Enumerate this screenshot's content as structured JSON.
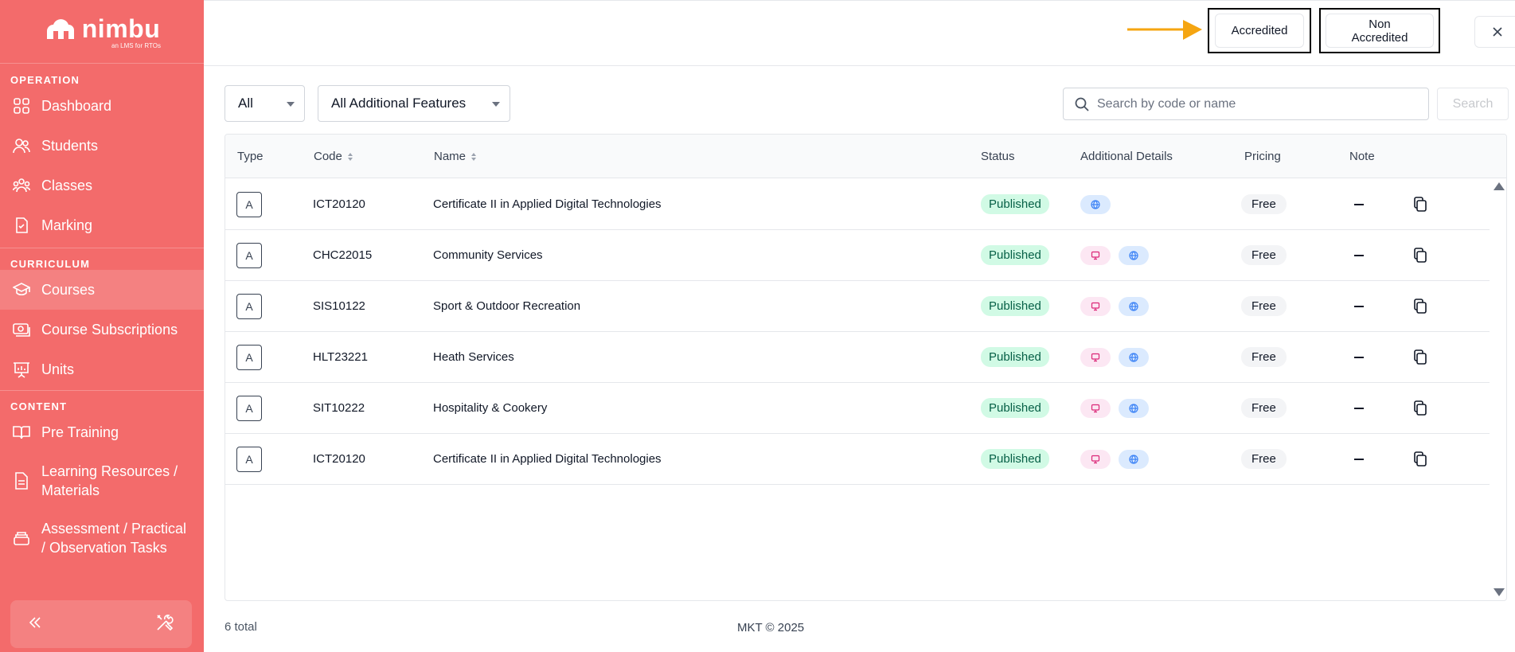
{
  "brand": {
    "name": "nimbu",
    "tagline": "an LMS for RTOs"
  },
  "sidebar": {
    "sections": [
      {
        "label": "OPERATION",
        "items": [
          {
            "label": "Dashboard",
            "icon": "grid-icon"
          },
          {
            "label": "Students",
            "icon": "users-icon"
          },
          {
            "label": "Classes",
            "icon": "group-icon"
          },
          {
            "label": "Marking",
            "icon": "clipboard-check-icon"
          }
        ]
      },
      {
        "label": "CURRICULUM",
        "items": [
          {
            "label": "Courses",
            "icon": "graduation-cap-icon",
            "active": true
          },
          {
            "label": "Course Subscriptions",
            "icon": "money-icon"
          },
          {
            "label": "Units",
            "icon": "presentation-icon"
          }
        ]
      },
      {
        "label": "CONTENT",
        "items": [
          {
            "label": "Pre Training",
            "icon": "book-icon"
          },
          {
            "label": "Learning Resources / Materials",
            "icon": "document-icon"
          },
          {
            "label": "Assessment / Practical / Observation Tasks",
            "icon": "stack-icon"
          }
        ]
      }
    ]
  },
  "topbar": {
    "tabs": [
      {
        "label": "Accredited"
      },
      {
        "label": "Non Accredited"
      }
    ],
    "arrow_color": "#f5a511"
  },
  "filters": {
    "type_select": "All",
    "features_select": "All Additional Features",
    "search_placeholder": "Search by code or name",
    "search_button": "Search"
  },
  "table": {
    "columns": [
      "Type",
      "Code",
      "Name",
      "Status",
      "Additional Details",
      "Pricing",
      "Note"
    ],
    "rows": [
      {
        "type": "A",
        "code": "ICT20120",
        "name": "Certificate II in Applied Digital Technologies",
        "status": "Published",
        "details": [
          "globe"
        ],
        "pricing": "Free"
      },
      {
        "type": "A",
        "code": "CHC22015",
        "name": "Community Services",
        "status": "Published",
        "details": [
          "monitor",
          "globe"
        ],
        "pricing": "Free"
      },
      {
        "type": "A",
        "code": "SIS10122",
        "name": "Sport & Outdoor Recreation",
        "status": "Published",
        "details": [
          "monitor",
          "globe"
        ],
        "pricing": "Free"
      },
      {
        "type": "A",
        "code": "HLT23221",
        "name": "Heath Services",
        "status": "Published",
        "details": [
          "monitor",
          "globe"
        ],
        "pricing": "Free"
      },
      {
        "type": "A",
        "code": "SIT10222",
        "name": "Hospitality & Cookery",
        "status": "Published",
        "details": [
          "monitor",
          "globe"
        ],
        "pricing": "Free"
      },
      {
        "type": "A",
        "code": "ICT20120",
        "name": "Certificate II in Applied Digital Technologies",
        "status": "Published",
        "details": [
          "monitor",
          "globe"
        ],
        "pricing": "Free"
      }
    ]
  },
  "footer": {
    "total": "6 total",
    "copyright": "MKT © 2025"
  },
  "colors": {
    "sidebar": "#f36b6b",
    "published_bg": "#d1fae5",
    "published_text": "#065f46"
  }
}
